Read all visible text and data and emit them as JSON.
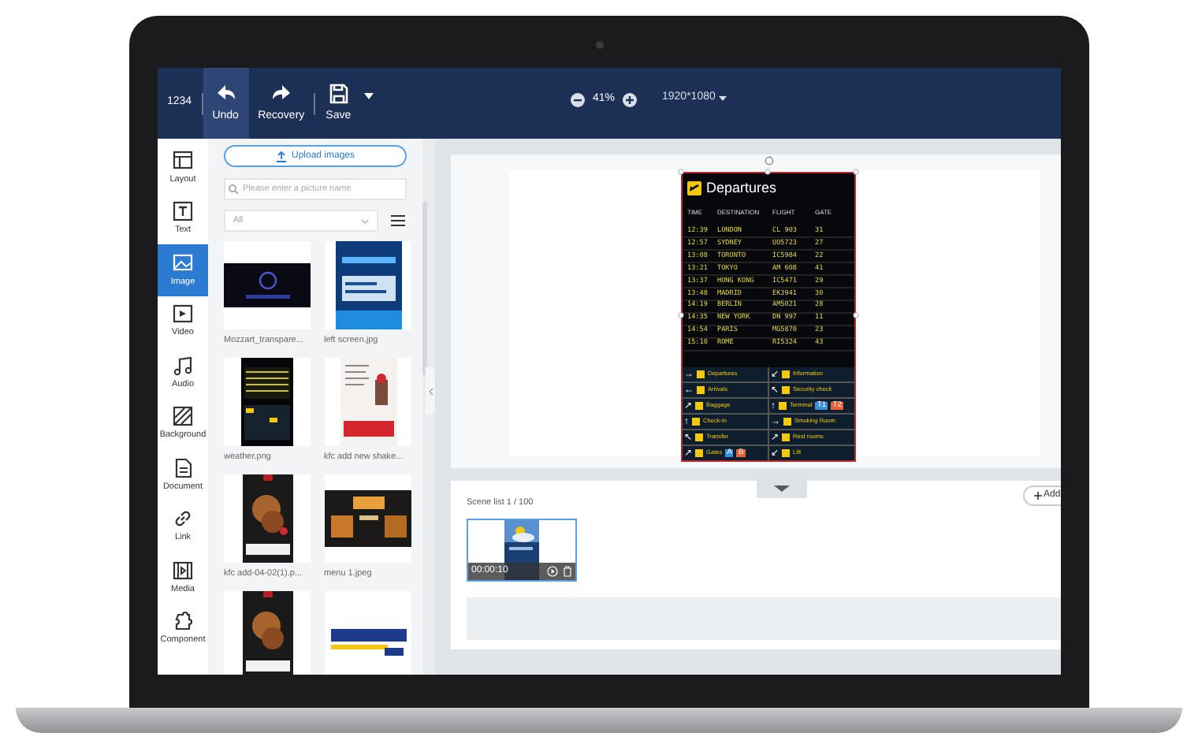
{
  "toolbar": {
    "project": "1234",
    "buttons": [
      {
        "label": "Undo",
        "selected": true
      },
      {
        "label": "Recovery",
        "selected": false
      },
      {
        "label": "Save",
        "selected": false
      }
    ],
    "zoom": "41%",
    "resolution": "1920*1080"
  },
  "sidebar": {
    "items": [
      {
        "label": "Layout",
        "selected": false
      },
      {
        "label": "Text",
        "selected": false
      },
      {
        "label": "Image",
        "selected": true
      },
      {
        "label": "Video",
        "selected": false
      },
      {
        "label": "Audio",
        "selected": false
      },
      {
        "label": "Background",
        "selected": false
      },
      {
        "label": "Document",
        "selected": false
      },
      {
        "label": "Link",
        "selected": false
      },
      {
        "label": "Media",
        "selected": false
      },
      {
        "label": "Component",
        "selected": false
      }
    ]
  },
  "image_panel": {
    "upload_button": "Upload images",
    "search": {
      "placeholder": "Please enter a picture name"
    },
    "filter": "All",
    "images": [
      {
        "kind": "picture",
        "caption": "Mozzart_transpare..."
      },
      {
        "kind": "picture",
        "caption": "left screen.jpg"
      },
      {
        "kind": "picture",
        "caption": "weather.png"
      },
      {
        "kind": "picture",
        "caption": "kfc add new shake..."
      },
      {
        "kind": "picture",
        "caption": "kfc add-04-02(1).p..."
      },
      {
        "kind": "picture",
        "caption": "menu 1.jpeg"
      },
      {
        "kind": "picture"
      },
      {
        "kind": "picture"
      }
    ]
  },
  "canvas": {
    "board": {
      "title": "Departures",
      "columns": [
        "TIME",
        "DESTINATION",
        "FLIGHT",
        "GATE"
      ],
      "rows": [
        [
          "12:39",
          "LONDON",
          "CL 903",
          "31"
        ],
        [
          "12:57",
          "SYDNEY",
          "UO5723",
          "27"
        ],
        [
          "13:08",
          "TORONTO",
          "IC5984",
          "22"
        ],
        [
          "13:21",
          "TOKYO",
          "AM 608",
          "41"
        ],
        [
          "13:37",
          "HONG KONG",
          "IC5471",
          "29"
        ],
        [
          "13:48",
          "MADRID",
          "EK3941",
          "30"
        ],
        [
          "14:19",
          "BERLIN",
          "AM5021",
          "28"
        ],
        [
          "14:35",
          "NEW YORK",
          "DN 997",
          "11"
        ],
        [
          "14:54",
          "PARIS",
          "MG5870",
          "23"
        ],
        [
          "15:10",
          "ROME",
          "RI5324",
          "43"
        ]
      ],
      "signs": [
        {
          "arrow": "→",
          "label": "Departures"
        },
        {
          "arrow": "↙",
          "label": "Information"
        },
        {
          "arrow": "←",
          "label": "Arrivals"
        },
        {
          "arrow": "↖",
          "label": "Security check"
        },
        {
          "arrow": "↗",
          "label": "Baggage"
        },
        {
          "arrow": "↑",
          "label": "Terminal",
          "badges": [
            "T1",
            "T2"
          ]
        },
        {
          "arrow": "↑",
          "label": "Check-in"
        },
        {
          "arrow": "→",
          "label": "Smoking Room"
        },
        {
          "arrow": "↖",
          "label": "Transfer"
        },
        {
          "arrow": "↗",
          "label": "Rest rooms"
        },
        {
          "arrow": "↗",
          "label": "Gates",
          "badges": [
            "A",
            "B"
          ]
        },
        {
          "arrow": "↙",
          "label": "Lift"
        }
      ]
    }
  },
  "scene_list": {
    "title": "Scene list 1 / 100",
    "add_button": "Add",
    "scenes": [
      {
        "duration": "00:00:10",
        "selected": true
      }
    ]
  }
}
